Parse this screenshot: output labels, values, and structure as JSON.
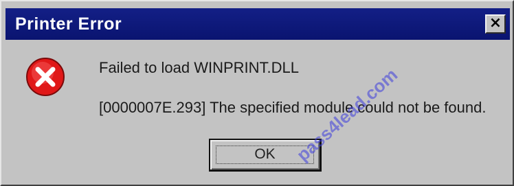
{
  "window": {
    "title": "Printer Error",
    "close_label": "×"
  },
  "message": {
    "line1": "Failed to load WINPRINT.DLL",
    "line2": "[0000007E.293] The specified module could not be found."
  },
  "buttons": {
    "ok_label": "OK"
  },
  "icon": {
    "name": "error-icon",
    "color": "#e01818"
  },
  "watermark": {
    "text": "pass4lead.com"
  }
}
